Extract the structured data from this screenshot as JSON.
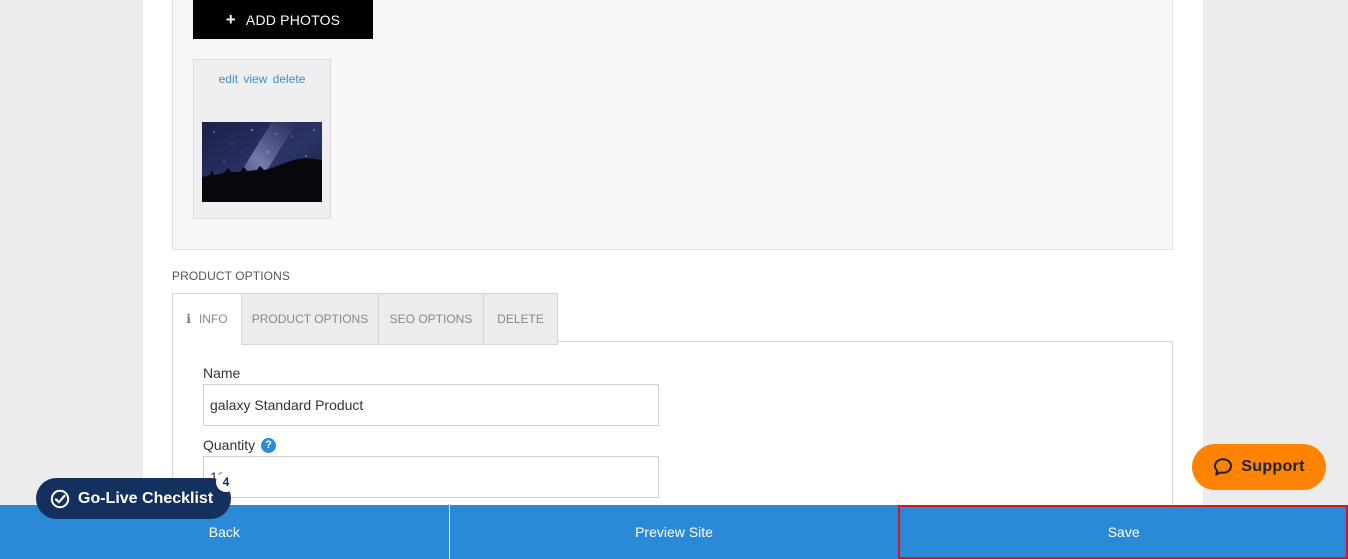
{
  "photos": {
    "add_label": "ADD PHOTOS",
    "thumb_actions": [
      "edit",
      "view",
      "delete"
    ]
  },
  "section_title": "PRODUCT OPTIONS",
  "tabs": [
    {
      "label": "INFO",
      "active": true
    },
    {
      "label": "PRODUCT OPTIONS",
      "active": false
    },
    {
      "label": "SEO OPTIONS",
      "active": false
    },
    {
      "label": "DELETE",
      "active": false
    }
  ],
  "form": {
    "name_label": "Name",
    "name_value": "galaxy Standard Product",
    "quantity_label": "Quantity",
    "quantity_help": "?",
    "quantity_value": "10"
  },
  "bottom_bar": {
    "back_label": "Back",
    "preview_label": "Preview Site",
    "save_label": "Save"
  },
  "golive": {
    "label": "Go-Live Checklist",
    "badge": "4"
  },
  "support": {
    "label": "Support"
  },
  "colors": {
    "primary": "#2a8ad8",
    "golive_bg": "#14305e",
    "support_bg": "#ff8300",
    "highlight": "#d8141c"
  }
}
